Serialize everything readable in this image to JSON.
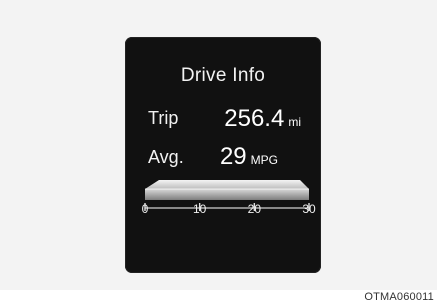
{
  "screen": {
    "title": "Drive Info",
    "trip": {
      "label": "Trip",
      "value": "256.4",
      "unit": "mi"
    },
    "average": {
      "label": "Avg.",
      "value": "29",
      "unit": "MPG"
    }
  },
  "gauge": {
    "ticks": [
      "0",
      "10",
      "20",
      "30"
    ],
    "min": 0,
    "max": 30,
    "level": 30
  },
  "figure_code": "OTMA060011",
  "colors": {
    "display_bg": "#111111",
    "text": "#f2f2f2",
    "bar_light": "#e6e6e6",
    "bar_dark": "#9a9a9a"
  }
}
